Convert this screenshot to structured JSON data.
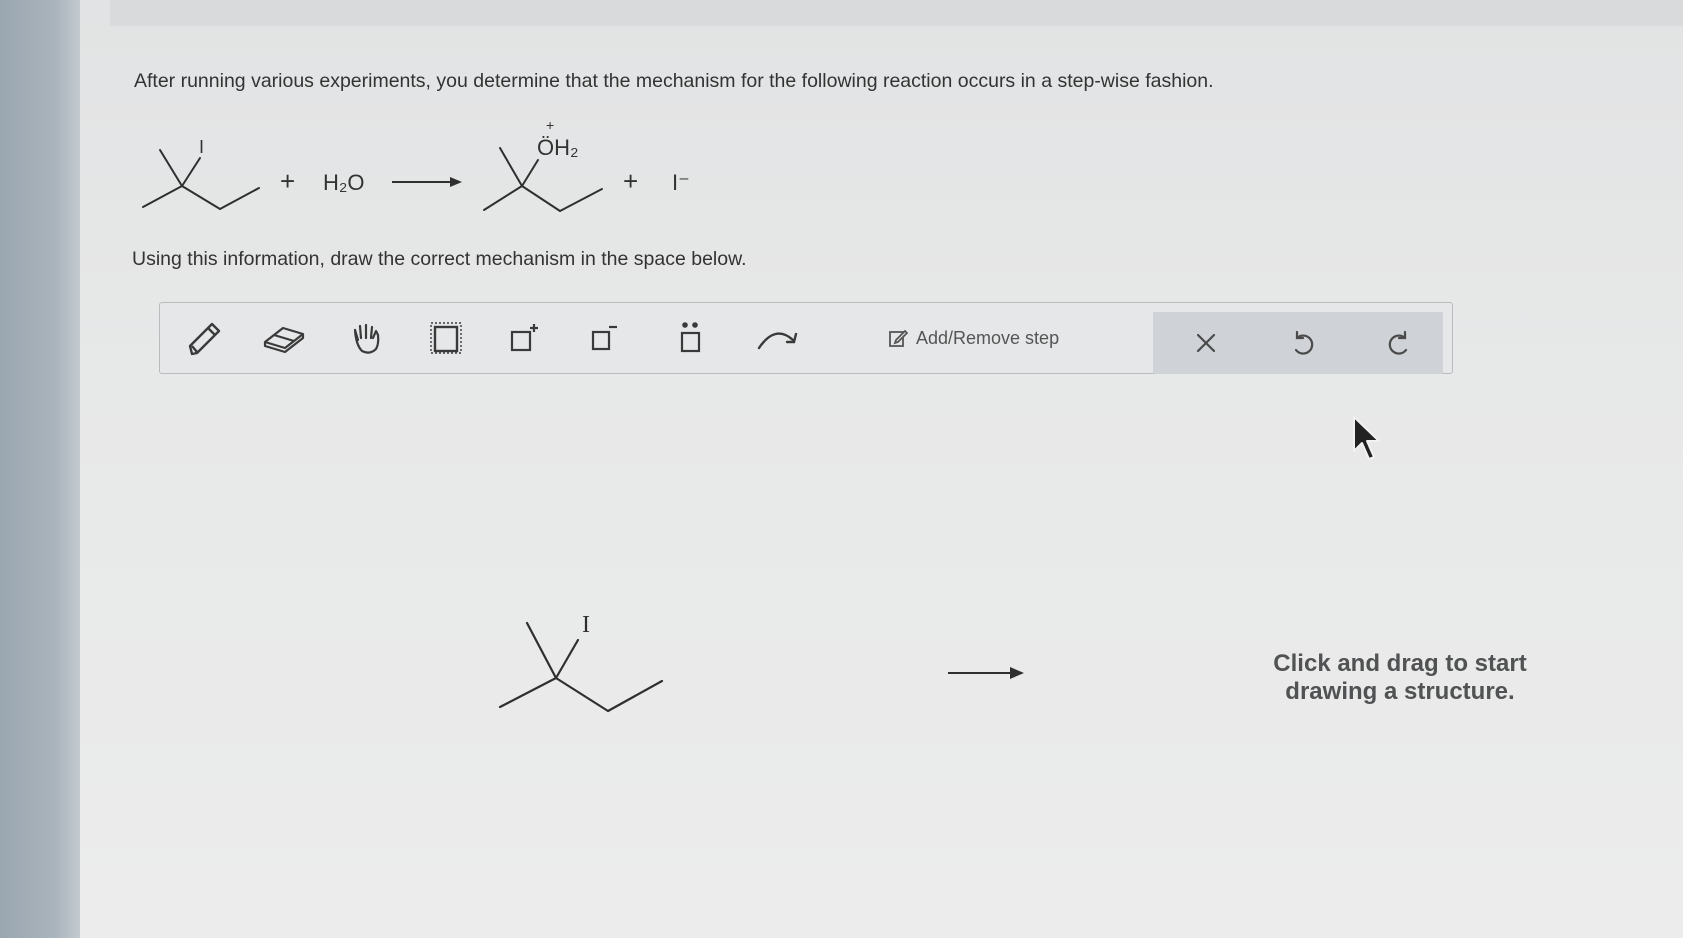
{
  "question": {
    "intro": "After running various experiments, you determine that the mechanism for the following reaction occurs in a step-wise fashion.",
    "task": "Using this information, draw the correct mechanism in the space below."
  },
  "equation": {
    "reactant_label": "I",
    "plus_1": "+",
    "water": "H₂O",
    "product_label": "ÖH₂",
    "product_charge": "+",
    "plus_2": "+",
    "iodide": "I⁻"
  },
  "toolbar": {
    "tools": [
      "pencil-icon",
      "eraser-icon",
      "hand-icon",
      "select-box-icon",
      "add-positive-charge-icon",
      "add-negative-charge-icon",
      "lone-pair-icon",
      "curved-arrow-icon"
    ],
    "step_button_label": "Add/Remove step",
    "actions": [
      "close-icon",
      "undo-icon",
      "redo-icon"
    ]
  },
  "canvas": {
    "atom_label": "I",
    "hint_line1": "Click and drag to start",
    "hint_line2": "drawing a structure."
  },
  "colors": {
    "page": "#e7e8e8",
    "toolbar_action_group": "#cfd2d6",
    "text": "#333333"
  }
}
